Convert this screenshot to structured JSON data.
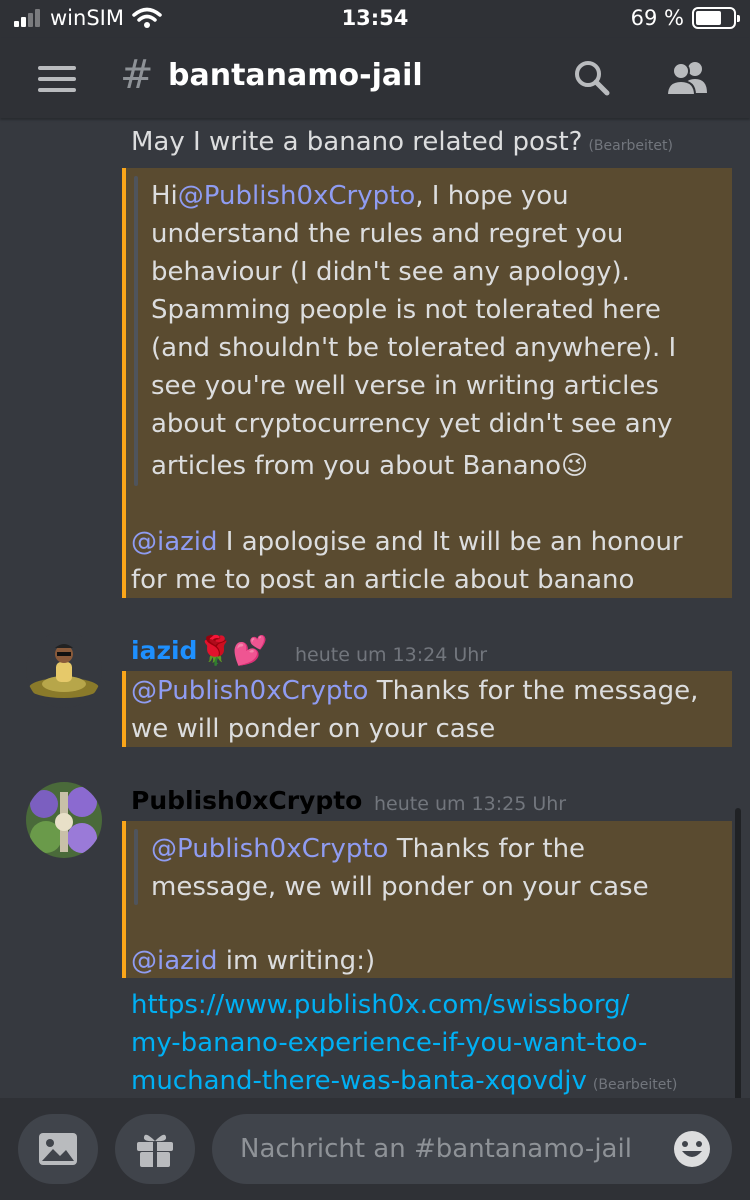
{
  "status_bar": {
    "carrier": "winSIM",
    "time": "13:54",
    "battery": "69 %",
    "battery_level": 0.69
  },
  "header": {
    "hash": "#",
    "channel_name": "bantanamo-jail"
  },
  "messages": {
    "cont_line": "May I write a banano related post?",
    "edited_label": "(Bearbeitet)",
    "quote1": {
      "first_prefix": "Hi",
      "first_mention": "@Publish0xCrypto",
      "first_suffix": ", I hope you",
      "lines": [
        "understand the rules and regret you",
        "behaviour (I didn't see any apology).",
        "Spamming people is not tolerated here",
        "(and shouldn't be tolerated anywhere). I",
        "see you're well verse in writing articles",
        "about cryptocurrency yet didn't see any",
        "articles from you about Banano"
      ],
      "emoji": "😉"
    },
    "reply1": {
      "mention": "@iazid",
      "line1": " I apologise and It will be an honour",
      "line2": "for me to post an article about banano"
    },
    "msg2": {
      "author": "iazid",
      "author_color": "#1e90ff",
      "emojis": "🌹💕",
      "timestamp": "heute um 13:24 Uhr",
      "mention": "@Publish0xCrypto",
      "line1": " Thanks for the message,",
      "line2": "we will ponder on your case"
    },
    "msg3": {
      "author": "Publish0xCrypto",
      "author_color": "#000000",
      "timestamp": "heute um 13:25 Uhr",
      "quote_mention": "@Publish0xCrypto",
      "quote_line1": " Thanks for the",
      "quote_line2": "message, we will ponder on your case",
      "reply_mention": "@iazid",
      "reply_text": " im writing:)",
      "link_lines": [
        "https://www.publish0x.com/swissborg/",
        "my-banano-experience-if-you-want-too-",
        "muchand-there-was-banta-xqovdjv"
      ],
      "edited_label": "(Bearbeitet)"
    }
  },
  "composer": {
    "placeholder": "Nachricht an #bantanamo-jail"
  },
  "colors": {
    "highlight_bg": "#5a4b30",
    "highlight_border": "#faa61a",
    "mention": "#8f9cf2",
    "link": "#00b0f4"
  }
}
